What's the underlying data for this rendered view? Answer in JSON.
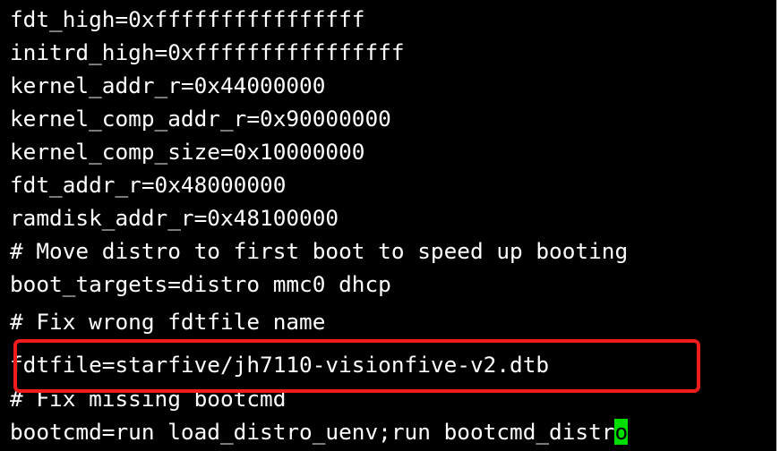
{
  "terminal": {
    "lines": [
      "fdt_high=0xffffffffffffffff",
      "initrd_high=0xffffffffffffffff",
      "kernel_addr_r=0x44000000",
      "kernel_comp_addr_r=0x90000000",
      "kernel_comp_size=0x10000000",
      "fdt_addr_r=0x48000000",
      "ramdisk_addr_r=0x48100000",
      "# Move distro to first boot to speed up booting",
      "boot_targets=distro mmc0 dhcp",
      "# Fix wrong fdtfile name",
      "fdtfile=starfive/jh7110-visionfive-v2.dtb",
      "# Fix missing bootcmd",
      "bootcmd=run load_distro_uenv;run bootcmd_distr"
    ],
    "cursor_char": "o"
  },
  "colors": {
    "background": "#000000",
    "text": "#ffffff",
    "cursor": "#00dd00",
    "highlight": "#ee1c1c"
  }
}
